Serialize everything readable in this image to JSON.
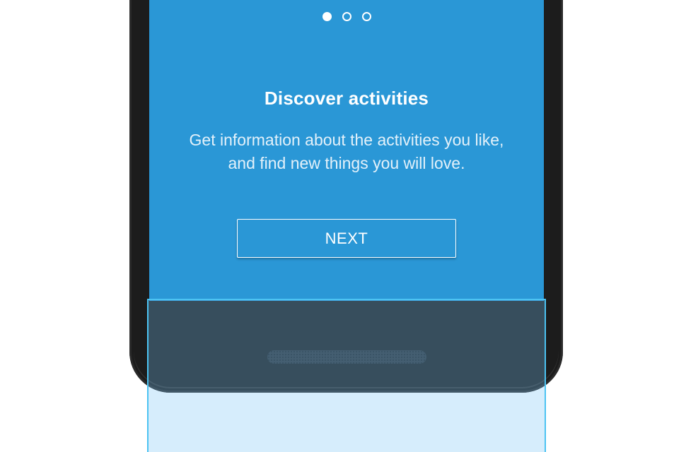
{
  "onboarding": {
    "pager": {
      "total": 3,
      "active_index": 0
    },
    "title": "Discover activities",
    "description_line1": "Get information about the activities you like,",
    "description_line2": "and find new things you will love.",
    "next_label": "NEXT"
  },
  "colors": {
    "screen_background": "#2a97d6",
    "phone_body": "#1c1c1c",
    "selection_border": "#4cc3f2"
  },
  "icons": {
    "speaker": "speaker-grille-icon"
  }
}
